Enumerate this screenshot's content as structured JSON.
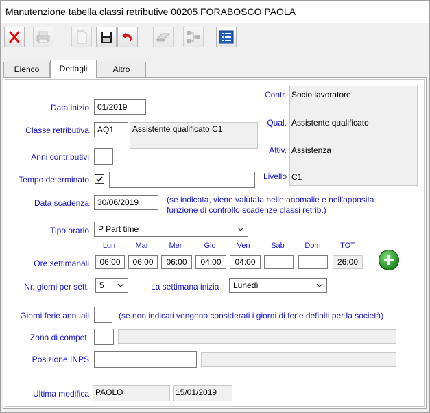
{
  "window": {
    "title": "Manutenzione tabella classi retributive 00205 FORABOSCO PAOLA"
  },
  "toolbar": {
    "icons": [
      "close-icon",
      "print-icon",
      "new-document-icon",
      "save-icon",
      "undo-icon",
      "eraser-icon",
      "hierarchy-icon",
      "list-icon"
    ]
  },
  "tabs": [
    {
      "label": "Elenco"
    },
    {
      "label": "Dettagli"
    },
    {
      "label": "Altro"
    }
  ],
  "form": {
    "data_inizio": {
      "label": "Data inizio",
      "value": "01/2019"
    },
    "classe_retributiva": {
      "label": "Classe retributiva",
      "code": "AQ1",
      "description": "Assistente qualificato C1"
    },
    "anni_contributivi": {
      "label": "Anni contributivi",
      "value": ""
    },
    "tempo_determinato": {
      "label": "Tempo determinato",
      "checked": true,
      "value": ""
    },
    "data_scadenza": {
      "label": "Data scadenza",
      "value": "30/06/2019",
      "note": "(se indicata, viene valutata nelle anomalie e nell'apposita funzione di controllo scadenze classi retrib.)"
    },
    "tipo_orario": {
      "label": "Tipo orario",
      "value": "P Part time"
    },
    "ore_settimanali": {
      "label": "Ore settimanali",
      "days": [
        {
          "name": "Lun",
          "value": "06:00"
        },
        {
          "name": "Mar",
          "value": "06:00"
        },
        {
          "name": "Mer",
          "value": "06:00"
        },
        {
          "name": "Gio",
          "value": "04:00"
        },
        {
          "name": "Ven",
          "value": "04:00"
        },
        {
          "name": "Sab",
          "value": ""
        },
        {
          "name": "Dom",
          "value": ""
        }
      ],
      "total_label": "TOT",
      "total_value": "26:00"
    },
    "giorni_per_sett": {
      "label": "Nr. giorni per sett.",
      "value": "5"
    },
    "settimana_inizia": {
      "label": "La settimana inizia",
      "value": "Lunedì"
    },
    "giorni_ferie": {
      "label": "Giorni ferie annuali",
      "value": "",
      "note": "(se non indicati vengono considerati i giorni di ferie definiti per la società)"
    },
    "zona_compet": {
      "label": "Zona di compet.",
      "value": "",
      "description": ""
    },
    "posizione_inps": {
      "label": "Posizione INPS",
      "value": "",
      "description": ""
    },
    "ultima_modifica": {
      "label": "Ultima modifica",
      "user": "PAOLO",
      "date": "15/01/2019"
    }
  },
  "info_box": {
    "contr": {
      "label": "Contr.",
      "value": "Socio lavoratore"
    },
    "qual": {
      "label": "Qual.",
      "value": "Assistente qualificato"
    },
    "attiv": {
      "label": "Attiv.",
      "value": "Assistenza"
    },
    "livello": {
      "label": "Livello",
      "value": "C1"
    }
  }
}
